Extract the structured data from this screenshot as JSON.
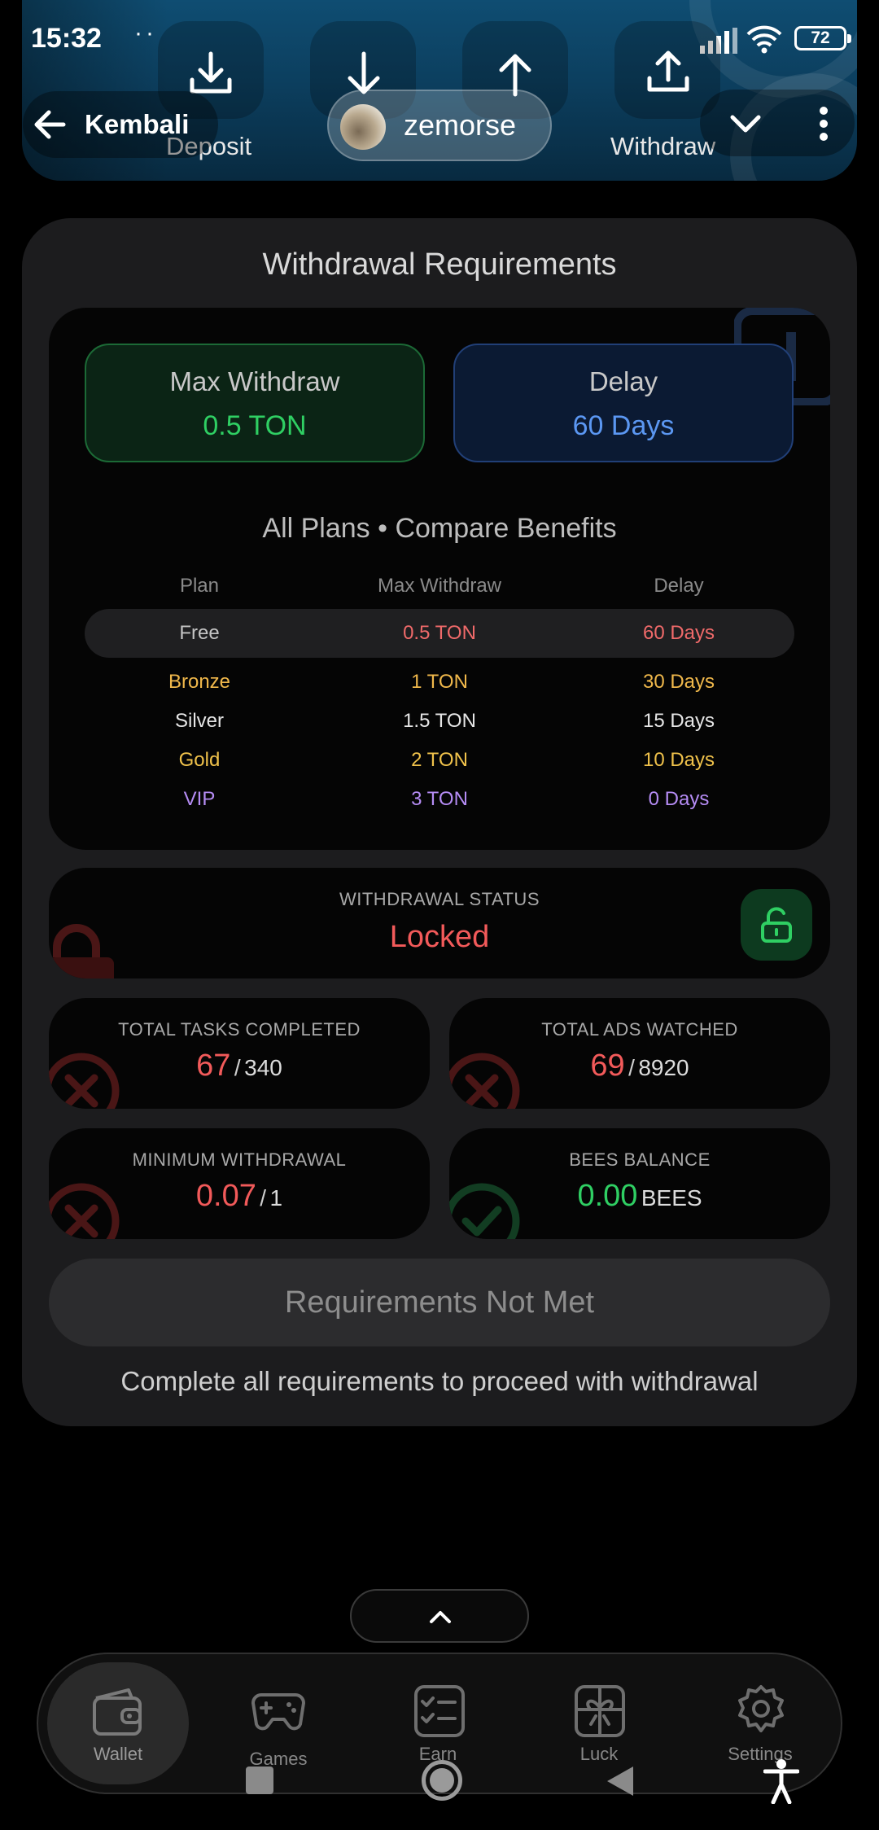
{
  "status_bar": {
    "time": "15:32",
    "dots": "··",
    "battery": "72"
  },
  "header": {
    "back_label": "Kembali",
    "username": "zemorse",
    "actions": [
      {
        "label": "Deposit",
        "icon": "download-tray-icon"
      },
      {
        "label": "",
        "icon": "arrow-down-icon"
      },
      {
        "label": "",
        "icon": "arrow-up-icon"
      },
      {
        "label": "Withdraw",
        "icon": "upload-tray-icon"
      }
    ]
  },
  "card": {
    "title": "Withdrawal Requirements",
    "max_withdraw": {
      "title": "Max Withdraw",
      "value": "0.5 TON"
    },
    "delay": {
      "title": "Delay",
      "value": "60 Days"
    },
    "plans_heading": "All Plans • Compare Benefits",
    "plans_table": {
      "headers": [
        "Plan",
        "Max Withdraw",
        "Delay"
      ],
      "rows": [
        {
          "plan": "Free",
          "max": "0.5 TON",
          "delay": "60 Days"
        },
        {
          "plan": "Bronze",
          "max": "1 TON",
          "delay": "30 Days"
        },
        {
          "plan": "Silver",
          "max": "1.5 TON",
          "delay": "15 Days"
        },
        {
          "plan": "Gold",
          "max": "2 TON",
          "delay": "10 Days"
        },
        {
          "plan": "VIP",
          "max": "3 TON",
          "delay": "0 Days"
        }
      ]
    },
    "withdrawal_status": {
      "label": "WITHDRAWAL STATUS",
      "value": "Locked"
    },
    "tasks": {
      "label": "TOTAL TASKS COMPLETED",
      "value": "67",
      "sep": "/",
      "total": "340"
    },
    "ads": {
      "label": "TOTAL ADS WATCHED",
      "value": "69",
      "sep": "/",
      "total": "8920"
    },
    "min_withdrawal": {
      "label": "MINIMUM WITHDRAWAL",
      "value": "0.07",
      "sep": "/",
      "total": "1"
    },
    "bees": {
      "label": "BEES BALANCE",
      "value": "0.00",
      "unit": "BEES"
    },
    "requirements_button": "Requirements Not Met",
    "note": "Complete all requirements to proceed with withdrawal"
  },
  "bottom_nav": {
    "items": [
      {
        "label": "Wallet",
        "icon": "wallet-icon",
        "active": true
      },
      {
        "label": "Games",
        "icon": "gamepad-icon",
        "active": false
      },
      {
        "label": "Earn",
        "icon": "checklist-icon",
        "active": false
      },
      {
        "label": "Luck",
        "icon": "gift-icon",
        "active": false
      },
      {
        "label": "Settings",
        "icon": "gear-icon",
        "active": false
      }
    ]
  },
  "colors": {
    "accent_green": "#2fcf63",
    "accent_blue": "#5b97f2",
    "status_red": "#f25a5a",
    "bronze": "#f0b84b",
    "vip_purple": "#b58cf4",
    "header_blue": "#0f4d72"
  }
}
